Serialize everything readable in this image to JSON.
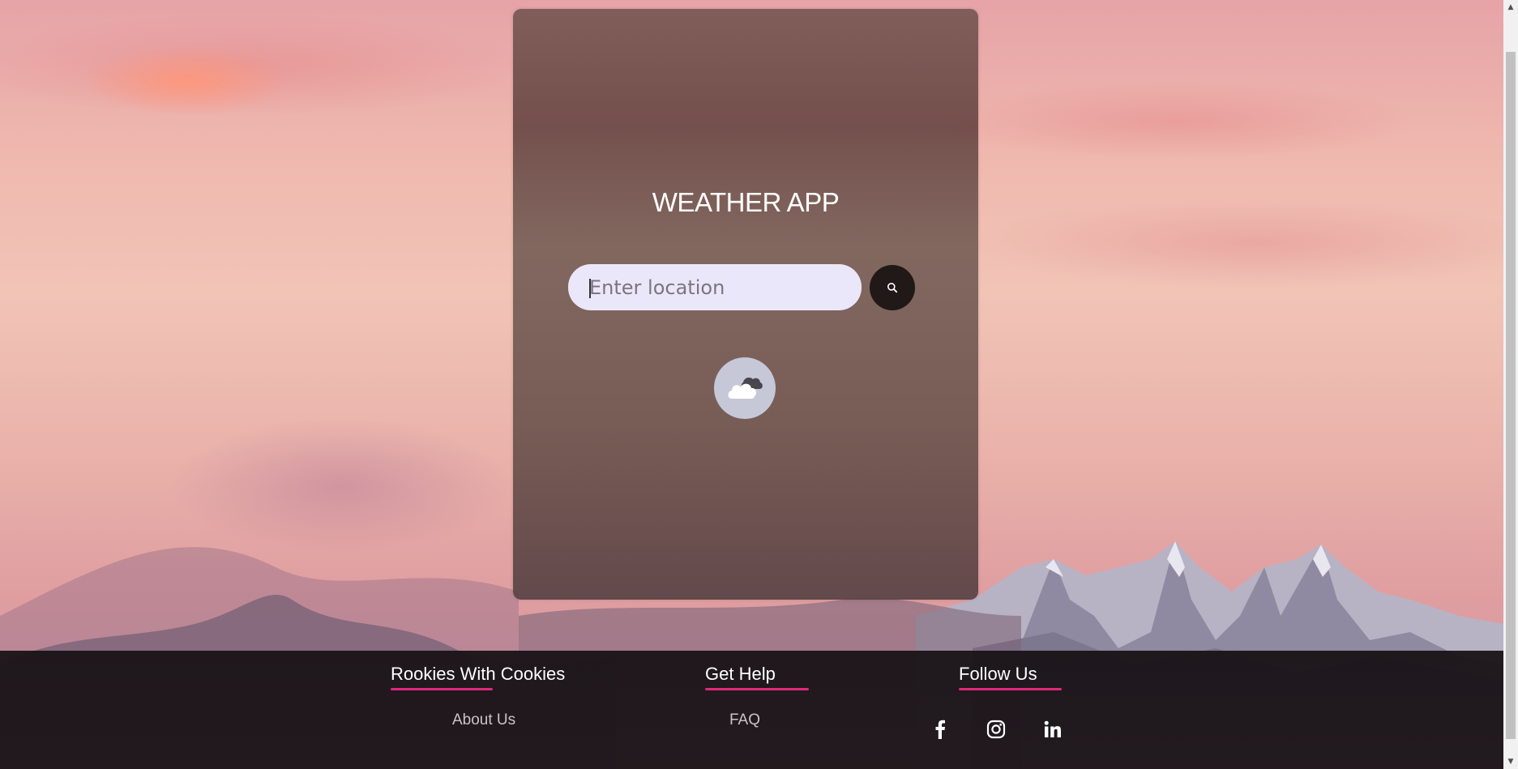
{
  "app": {
    "title": "WEATHER APP"
  },
  "search": {
    "placeholder": "Enter location",
    "value": "",
    "button_icon": "search-icon"
  },
  "weather": {
    "icon": "cloudy-icon"
  },
  "footer": {
    "columns": [
      {
        "heading": "Rookies With Cookies",
        "links": [
          "About Us"
        ]
      },
      {
        "heading": "Get Help",
        "links": [
          "FAQ"
        ]
      },
      {
        "heading": "Follow Us",
        "social": [
          "facebook-icon",
          "instagram-icon",
          "linkedin-icon"
        ]
      }
    ]
  },
  "colors": {
    "accent_underline": "#e0287a",
    "input_background": "#ebe7fb",
    "search_button": "#201917",
    "footer_background": "#181216"
  }
}
